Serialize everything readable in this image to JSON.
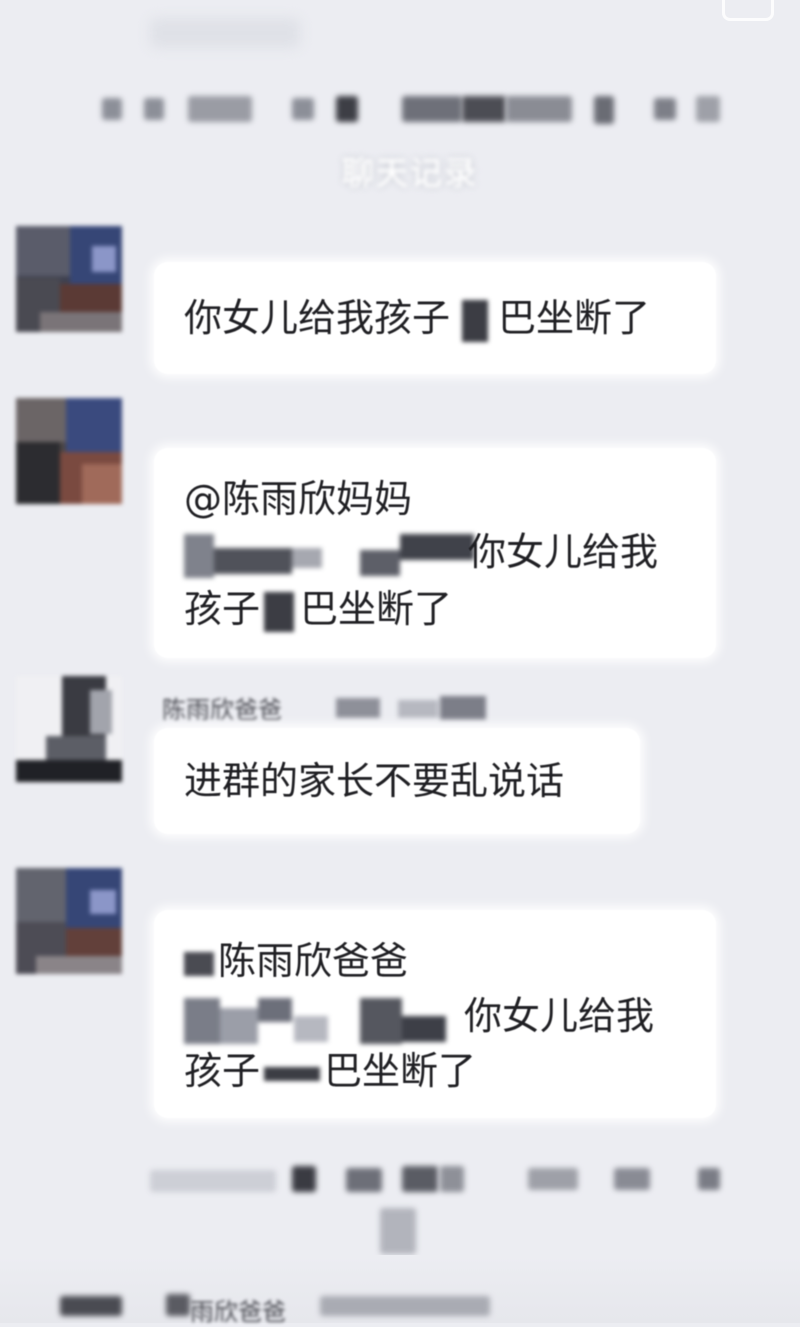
{
  "header": {
    "title": "聊天记录"
  },
  "messages": [
    {
      "text_before": "你女儿给我孩子",
      "text_after": "巴坐断了"
    },
    {
      "mention": "@陈雨欣妈妈",
      "line2_text": "你女儿给我",
      "line3_before": "孩子",
      "line3_after": "巴坐断了"
    },
    {
      "sender": "陈雨欣爸爸",
      "text": "进群的家长不要乱说话"
    },
    {
      "mention": "陈雨欣爸爸",
      "line2_text": "你女儿给我",
      "line3_before": "孩子",
      "line3_after": "巴坐断了"
    }
  ],
  "footer": {
    "partial_sender": "雨欣爸爸"
  }
}
